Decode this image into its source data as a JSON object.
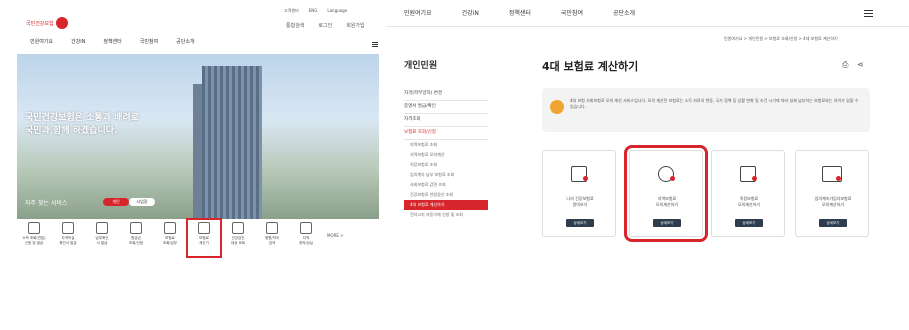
{
  "left": {
    "logo_text": "국민건강보험",
    "utility": [
      "고객센터",
      "ENG",
      "Language"
    ],
    "utility_actions": [
      "통합검색",
      "로그인",
      "회원가입"
    ],
    "nav": [
      "민원여기요",
      "건강iN",
      "정책센터",
      "국민참여",
      "공단소개"
    ],
    "hero_title_line1": "국민건강보험은 소통과 배려로",
    "hero_title_line2": "국민과 함께 하겠습니다.",
    "hero_sub": "자주 찾는 서비스",
    "pill_personal": "개인",
    "pill_business": "사업장",
    "services": [
      {
        "label": "소득 조회(연말)\n신청 및 발급",
        "icon": "document-icon"
      },
      {
        "label": "자격득실\n확인서 발급",
        "icon": "certificate-icon"
      },
      {
        "label": "납부확인\n서 발급",
        "icon": "search-doc-icon"
      },
      {
        "label": "환급금\n조회/신청",
        "icon": "refund-icon"
      },
      {
        "label": "보험료\n조회/납부",
        "icon": "monitor-icon"
      },
      {
        "label": "보험료\n계산기",
        "icon": "calculator-icon"
      },
      {
        "label": "건강검진\n대상 조회",
        "icon": "person-icon"
      },
      {
        "label": "병원/약국\n검색",
        "icon": "hospital-icon"
      },
      {
        "label": "자격\n취득/상실",
        "icon": "people-icon"
      }
    ],
    "more_label": "MORE >"
  },
  "right": {
    "nav": [
      "민원여기요",
      "건강iN",
      "정책센터",
      "국민참여",
      "공단소개"
    ],
    "breadcrumb": "민원여기요 > 개인민원 > 보험료 조회/신청 > 4대 보험료 계산하기",
    "side_title": "개인민원",
    "side_items": [
      "자격(피부양자) 변경",
      "증명서 발급/확인",
      "자격조회",
      "보험료 조회/신청"
    ],
    "side_subs": [
      "지역보험료 조회",
      "지역보험료 모의계산",
      "직장보험료 조회",
      "임의계속 납부 보험료 조회",
      "사회보험료 감면 조회",
      "건강보험료 연말정산 조회",
      "4대 보험료 계산하기",
      "전자고지 자동이체 신청 및 조회"
    ],
    "active_sub_index": 6,
    "page_title": "4대 보험료 계산하기",
    "notice": "4대 보험 사회보험료 모의 계산 서비스입니다. 모의 계산된 보험료는 소득 자료의 변동, 국가 정책 등 상황 변화 및 조건 시기에 따라 실제 납부하는 보험료와는 차이가 있을 수 있습니다.",
    "cards": [
      {
        "label": "나의 건강보험료\n알아보기",
        "icon": "doc-icon",
        "button": "상세보기"
      },
      {
        "label": "지역보험료\n모의계산하기",
        "icon": "globe-icon",
        "button": "상세보기"
      },
      {
        "label": "직장보험료\n모의계산하기",
        "icon": "building-icon",
        "button": "상세보기"
      },
      {
        "label": "임의계속가입자보험료\n모의계산하기",
        "icon": "monitor-icon",
        "button": "상세보기"
      }
    ],
    "highlight_card_index": 1
  }
}
